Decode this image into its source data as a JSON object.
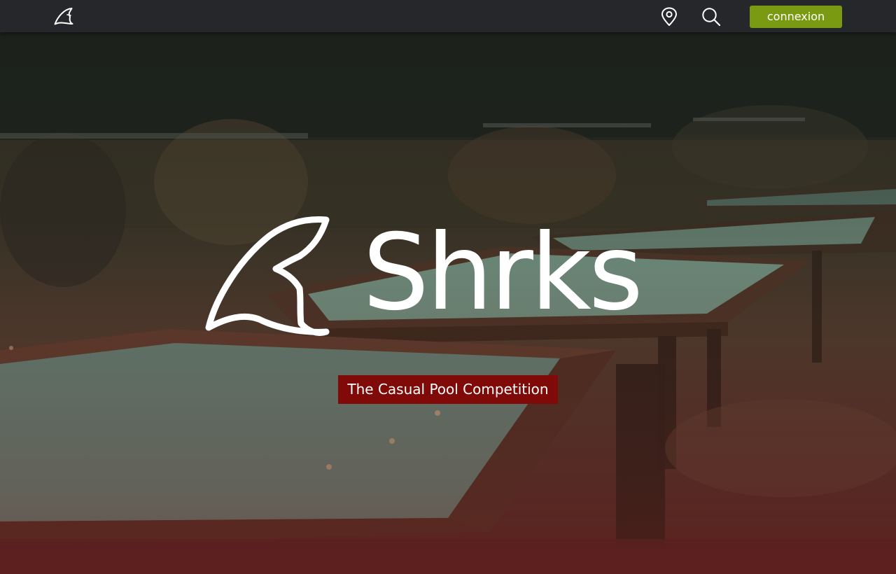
{
  "nav": {
    "logo_icon": "shark-fin-icon",
    "location_icon": "map-pin-icon",
    "search_icon": "search-icon",
    "connexion_label": "connexion"
  },
  "hero": {
    "background": "pool-hall-photo",
    "brand_icon": "shark-fin-icon",
    "brand_name": "Shrks",
    "tagline": "The Casual Pool Competition"
  },
  "colors": {
    "navbar": "#26272b",
    "accent_green": "#7a9a12",
    "tagline_bg": "#7f0a08",
    "brand_text": "#ffffff"
  }
}
